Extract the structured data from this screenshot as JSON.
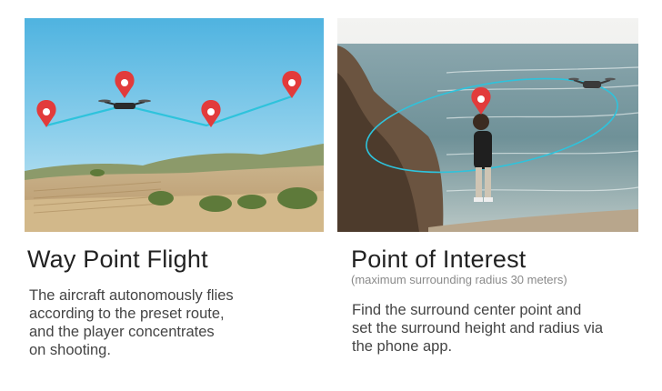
{
  "features": [
    {
      "title": "Way Point Flight",
      "description_lines": [
        "The aircraft autonomously flies",
        "according to the preset route,",
        "and the player concentrates",
        "on shooting."
      ],
      "icons": [
        "location-pin-icon",
        "drone-icon"
      ]
    },
    {
      "title": "Point of Interest",
      "subtitle": "(maximum surrounding radius 30 meters)",
      "description_lines": [
        "Find the surround center point and",
        "set the surround height and radius via",
        "the phone app."
      ],
      "icons": [
        "location-pin-icon",
        "drone-icon"
      ]
    }
  ],
  "colors": {
    "pin_red": "#e23b3b",
    "route_cyan": "#2ec3dc",
    "title_text": "#222222",
    "subtitle_text": "#8a8a8a",
    "body_text": "#444444"
  }
}
